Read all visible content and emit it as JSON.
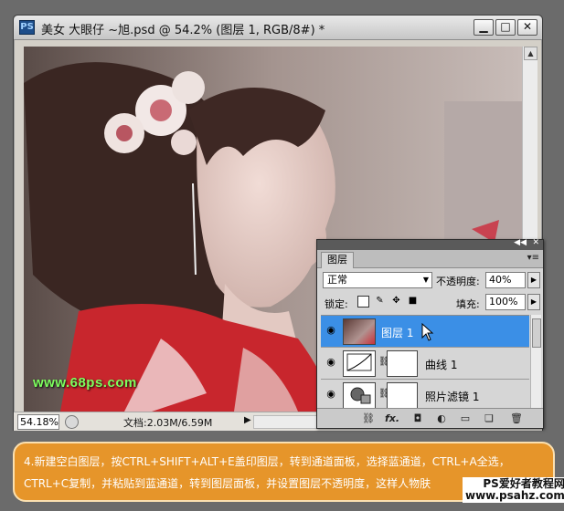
{
  "document": {
    "app_icon": "PS",
    "title": "美女 大眼仔 ~旭.psd @ 54.2% (图层 1, RGB/8#) *",
    "window_buttons": {
      "minimize": "▁",
      "maximize": "□",
      "close": "✕"
    },
    "watermark": "www.68ps.com",
    "status": {
      "zoom": "54.18%",
      "doc_size": "文档:2.03M/6.59M",
      "arrow": "▶"
    }
  },
  "layers_panel": {
    "tab": "图层",
    "blend_mode": "正常",
    "opacity_label": "不透明度:",
    "opacity": "40%",
    "lock_label": "锁定:",
    "fill_label": "填充:",
    "fill": "100%",
    "layers": [
      {
        "name": "图层 1",
        "selected": true
      },
      {
        "name": "曲线 1",
        "selected": false
      },
      {
        "name": "照片滤镜 1",
        "selected": false
      }
    ],
    "bottom_icons": [
      "link-icon",
      "fx-icon",
      "mask-icon",
      "adjustment-icon",
      "group-icon",
      "new-layer-icon",
      "trash-icon"
    ],
    "bottom_glyphs": [
      "⛓",
      "fx.",
      "◘",
      "◐",
      "▭",
      "❏",
      "🗑"
    ]
  },
  "caption": {
    "text": "4.新建空白图层，按CTRL+SHIFT+ALT+E盖印图层，转到通道面板，选择蓝通道，CTRL+A全选，CTRL+C复制，并粘贴到蓝通道，转到图层面板，并设置图层不透明度，这样人物肤"
  },
  "brand": {
    "line1": "PS爱好者教程网",
    "line2": "www.psahz.com"
  }
}
